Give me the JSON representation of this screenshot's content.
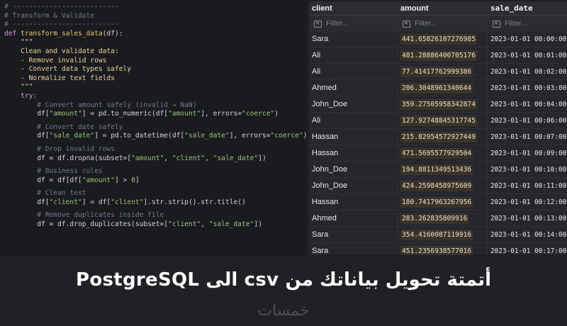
{
  "code_lines": [
    {
      "parts": [
        {
          "t": "# --------------------------",
          "c": "c-comment"
        }
      ]
    },
    {
      "parts": [
        {
          "t": "# Transform & Validate",
          "c": "c-comment"
        }
      ]
    },
    {
      "parts": [
        {
          "t": "# --------------------------",
          "c": "c-comment"
        }
      ]
    },
    {
      "parts": [
        {
          "t": "def ",
          "c": "c-kw"
        },
        {
          "t": "transform_sales_data",
          "c": "c-fn"
        },
        {
          "t": "(df):",
          "c": "c-var"
        }
      ]
    },
    {
      "parts": [
        {
          "t": "    \"\"\"",
          "c": "c-doc"
        }
      ]
    },
    {
      "parts": [
        {
          "t": "    Clean and validate data:",
          "c": "c-doc"
        }
      ]
    },
    {
      "parts": [
        {
          "t": "    - Remove invalid rows",
          "c": "c-doc"
        }
      ]
    },
    {
      "parts": [
        {
          "t": "    - Convert data types safely",
          "c": "c-doc"
        }
      ]
    },
    {
      "parts": [
        {
          "t": "    - Normalize text fields",
          "c": "c-doc"
        }
      ]
    },
    {
      "parts": [
        {
          "t": "    \"\"\"",
          "c": "c-doc"
        }
      ]
    },
    {
      "parts": [
        {
          "t": "    try:",
          "c": "c-kw"
        }
      ]
    },
    {
      "parts": [
        {
          "t": "        # Convert amount safely (invalid → NaN)",
          "c": "c-comment"
        }
      ]
    },
    {
      "parts": [
        {
          "t": "        df[",
          "c": "c-var"
        },
        {
          "t": "\"amount\"",
          "c": "c-str"
        },
        {
          "t": "] = pd.to_numeric(df[",
          "c": "c-var"
        },
        {
          "t": "\"amount\"",
          "c": "c-str"
        },
        {
          "t": "], errors=",
          "c": "c-var"
        },
        {
          "t": "\"coerce\"",
          "c": "c-str"
        },
        {
          "t": ")",
          "c": "c-var"
        }
      ]
    },
    {
      "blank": true
    },
    {
      "parts": [
        {
          "t": "        # Convert date safely",
          "c": "c-comment"
        }
      ]
    },
    {
      "parts": [
        {
          "t": "        df[",
          "c": "c-var"
        },
        {
          "t": "\"sale_date\"",
          "c": "c-str"
        },
        {
          "t": "] = pd.to_datetime(df[",
          "c": "c-var"
        },
        {
          "t": "\"sale_date\"",
          "c": "c-str"
        },
        {
          "t": "], errors=",
          "c": "c-var"
        },
        {
          "t": "\"coerce\"",
          "c": "c-str"
        },
        {
          "t": ")",
          "c": "c-var"
        }
      ]
    },
    {
      "blank": true
    },
    {
      "parts": [
        {
          "t": "        # Drop invalid rows",
          "c": "c-comment"
        }
      ]
    },
    {
      "parts": [
        {
          "t": "        df = df.dropna(subset=[",
          "c": "c-var"
        },
        {
          "t": "\"amount\"",
          "c": "c-str"
        },
        {
          "t": ", ",
          "c": "c-var"
        },
        {
          "t": "\"client\"",
          "c": "c-str"
        },
        {
          "t": ", ",
          "c": "c-var"
        },
        {
          "t": "\"sale_date\"",
          "c": "c-str"
        },
        {
          "t": "])",
          "c": "c-var"
        }
      ]
    },
    {
      "blank": true
    },
    {
      "parts": [
        {
          "t": "        # Business rules",
          "c": "c-comment"
        }
      ]
    },
    {
      "parts": [
        {
          "t": "        df = df[df[",
          "c": "c-var"
        },
        {
          "t": "\"amount\"",
          "c": "c-str"
        },
        {
          "t": "] > ",
          "c": "c-var"
        },
        {
          "t": "0",
          "c": "c-num"
        },
        {
          "t": "]",
          "c": "c-var"
        }
      ]
    },
    {
      "blank": true
    },
    {
      "parts": [
        {
          "t": "        # Clean text",
          "c": "c-comment"
        }
      ]
    },
    {
      "parts": [
        {
          "t": "        df[",
          "c": "c-var"
        },
        {
          "t": "\"client\"",
          "c": "c-str"
        },
        {
          "t": "] = df[",
          "c": "c-var"
        },
        {
          "t": "\"client\"",
          "c": "c-str"
        },
        {
          "t": "].str.strip().str.title()",
          "c": "c-var"
        }
      ]
    },
    {
      "blank": true
    },
    {
      "parts": [
        {
          "t": "        # Remove duplicates inside file",
          "c": "c-comment"
        }
      ]
    },
    {
      "parts": [
        {
          "t": "        df = df.drop_duplicates(subset=[",
          "c": "c-var"
        },
        {
          "t": "\"client\"",
          "c": "c-str"
        },
        {
          "t": ", ",
          "c": "c-var"
        },
        {
          "t": "\"sale_date\"",
          "c": "c-str"
        },
        {
          "t": "])",
          "c": "c-var"
        }
      ]
    }
  ],
  "table": {
    "columns": [
      "client",
      "amount",
      "sale_date"
    ],
    "filter_placeholder": "Filter...",
    "rows": [
      {
        "client": "Sara",
        "amount": "441.65826107276985",
        "sale_date": "2023-01-01 00:00:00"
      },
      {
        "client": "Ali",
        "amount": "481.28886400705176",
        "sale_date": "2023-01-01 00:01:00"
      },
      {
        "client": "Ali",
        "amount": "77.41417762999386",
        "sale_date": "2023-01-01 00:02:00"
      },
      {
        "client": "Ahmed",
        "amount": "206.3048961340644",
        "sale_date": "2023-01-01 00:03:00"
      },
      {
        "client": "John_Doe",
        "amount": "359.27505958342874",
        "sale_date": "2023-01-01 00:04:00"
      },
      {
        "client": "Ali",
        "amount": "127.92748845317745",
        "sale_date": "2023-01-01 00:06:00"
      },
      {
        "client": "Hassan",
        "amount": "215.82954572927449",
        "sale_date": "2023-01-01 00:07:00"
      },
      {
        "client": "Hassan",
        "amount": "471.5695577929504",
        "sale_date": "2023-01-01 00:09:00"
      },
      {
        "client": "John_Doe",
        "amount": "194.8811349513436",
        "sale_date": "2023-01-01 00:10:00"
      },
      {
        "client": "John_Doe",
        "amount": "424.2598458975609",
        "sale_date": "2023-01-01 00:11:00"
      },
      {
        "client": "Hassan",
        "amount": "180.7417963267956",
        "sale_date": "2023-01-01 00:12:00"
      },
      {
        "client": "Ahmed",
        "amount": "283.262835809916",
        "sale_date": "2023-01-01 00:13:00"
      },
      {
        "client": "Sara",
        "amount": "354.4160087119916",
        "sale_date": "2023-01-01 00:14:00"
      },
      {
        "client": "Sara",
        "amount": "451.2356938577016",
        "sale_date": "2023-01-01 00:17:00"
      }
    ]
  },
  "headline": "أتمتة تحويل بياناتك من csv  الى PostgreSQL",
  "brand": "خمسات"
}
